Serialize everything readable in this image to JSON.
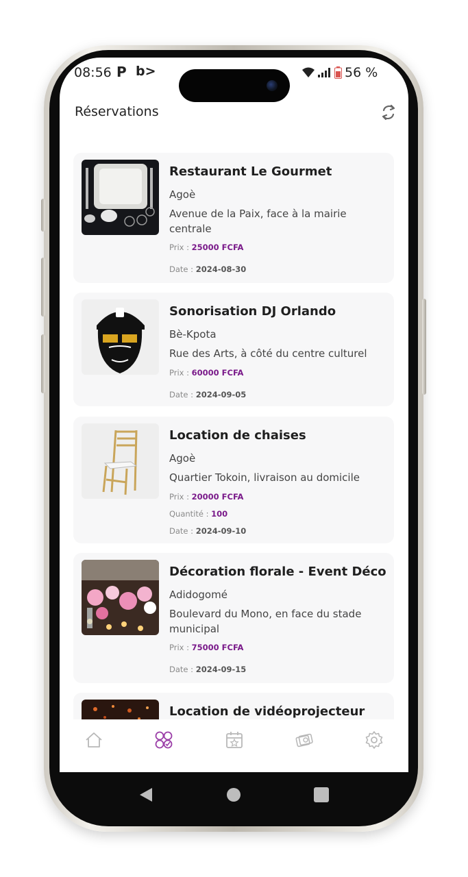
{
  "status_bar": {
    "time": "08:56",
    "left_icons": [
      "P",
      "b>"
    ],
    "battery_percent": "56 %"
  },
  "header": {
    "title": "Réservations",
    "refresh_icon": "refresh-icon"
  },
  "reservations": [
    {
      "name": "Restaurant Le Gourmet",
      "city": "Agoè",
      "address": "Avenue de la Paix, face à la mairie centrale",
      "price_label": "Prix : ",
      "price": "25000 FCFA",
      "date_label": "Date : ",
      "date": "2024-08-30",
      "image": "tableware-image"
    },
    {
      "name": "Sonorisation DJ Orlando",
      "city": "Bè-Kpota",
      "address": "Rue des Arts, à côté du centre culturel",
      "price_label": "Prix : ",
      "price": "60000 FCFA",
      "date_label": "Date : ",
      "date": "2024-09-05",
      "image": "dj-portrait-image"
    },
    {
      "name": "Location de chaises",
      "city": "Agoè",
      "address": "Quartier Tokoin, livraison au domicile",
      "price_label": "Prix : ",
      "price": "20000 FCFA",
      "quantity_label": "Quantité : ",
      "quantity": "100",
      "date_label": "Date : ",
      "date": "2024-09-10",
      "image": "chair-image"
    },
    {
      "name": "Décoration florale - Event Déco",
      "city": "Adidogomé",
      "address": "Boulevard du Mono, en face du stade municipal",
      "price_label": "Prix : ",
      "price": "75000 FCFA",
      "date_label": "Date : ",
      "date": "2024-09-15",
      "image": "flowers-image"
    },
    {
      "name": "Location de vidéoprojecteur",
      "image": "projector-image"
    }
  ],
  "bottom_nav": [
    {
      "name": "home-icon",
      "active": false
    },
    {
      "name": "reservations-icon",
      "active": true
    },
    {
      "name": "calendar-icon",
      "active": false
    },
    {
      "name": "payments-icon",
      "active": false
    },
    {
      "name": "settings-icon",
      "active": false
    }
  ],
  "colors": {
    "accent": "#7a1a8a",
    "card_bg": "#f7f7f8",
    "nav_inactive": "#b8b8b8",
    "nav_active": "#9b3fa8"
  }
}
